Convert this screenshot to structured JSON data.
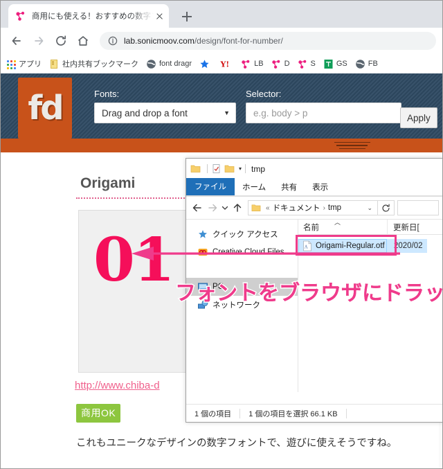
{
  "browser": {
    "tab": {
      "title": "商用にも使える！おすすめの数字フォ",
      "favicon": "fontdragr-icon",
      "close": "close-icon"
    },
    "new_tab_label": "+",
    "nav": {
      "back": "back-arrow-icon",
      "forward": "forward-arrow-icon",
      "reload": "reload-icon",
      "home": "home-icon"
    },
    "omnibox": {
      "info_icon": "info-circle-icon",
      "url_domain": "lab.sonicmoov.com",
      "url_path": "/design/font-for-number/"
    },
    "bookmarks": [
      {
        "label": "アプリ",
        "icon": "apps-grid-icon"
      },
      {
        "label": "社内共有ブックマーク",
        "icon": "document-icon"
      },
      {
        "label": "font dragr",
        "icon": "globe-icon"
      },
      {
        "label": "",
        "icon": "star-icon"
      },
      {
        "label": "",
        "icon": "yahoo-icon"
      },
      {
        "label": "LB",
        "icon": "fontdragr-icon"
      },
      {
        "label": "D",
        "icon": "fontdragr-icon"
      },
      {
        "label": "S",
        "icon": "fontdragr-icon"
      },
      {
        "label": "GS",
        "icon": "sheets-icon"
      },
      {
        "label": "FB",
        "icon": "globe-icon"
      }
    ]
  },
  "fontdragr": {
    "logo_text": "fd",
    "fonts_label": "Fonts:",
    "fonts_selected": "Drag and drop a font",
    "selector_label": "Selector:",
    "selector_placeholder": "e.g. body > p",
    "apply_label": "Apply",
    "colors": {
      "bar": "#2f4a63",
      "accent": "#c8521a"
    }
  },
  "page": {
    "heading": "Origami",
    "sample_number": "01",
    "link_text": "http://www.chiba-d",
    "badge": "商用OK",
    "paragraph": "これもユニークなデザインの数字フォントで、遊びに使えそうですね。",
    "colors": {
      "sample": "#f50f5a",
      "link": "#f0608c",
      "badge_bg": "#8dc63f"
    }
  },
  "annotation": {
    "caption": "フォントをブラウザにドラッグ",
    "arrow": "left-arrow-annotation",
    "color": "#ef3b8b"
  },
  "explorer": {
    "title": "tmp",
    "quick_access_icons": [
      "folder-icon",
      "properties-icon",
      "new-folder-icon",
      "customize-caret-icon"
    ],
    "ribbon_tabs": [
      "ファイル",
      "ホーム",
      "共有",
      "表示"
    ],
    "address": {
      "back": "back-arrow-icon",
      "forward": "forward-arrow-icon",
      "recent": "chevron-down-icon",
      "up": "up-arrow-icon",
      "crumb_icon": "folder-icon",
      "crumb_prefix": "«",
      "crumb_1": "ドキュメント",
      "crumb_sep": "›",
      "crumb_2": "tmp",
      "dropdown": "chevron-down-icon",
      "refresh": "refresh-icon"
    },
    "nav_items": [
      {
        "label": "クイック アクセス",
        "icon": "star-pin-icon",
        "selected": false
      },
      {
        "label": "Creative Cloud Files",
        "icon": "creative-cloud-icon",
        "selected": false
      },
      {
        "label": "PC",
        "icon": "this-pc-icon",
        "selected": true
      },
      {
        "label": "ネットワーク",
        "icon": "network-icon",
        "selected": false
      }
    ],
    "columns": [
      "名前",
      "更新日[",
      "sort-ascending-caret"
    ],
    "rows": [
      {
        "name": "Origami-Regular.otf",
        "icon": "font-file-icon",
        "date": "2020/02",
        "selected": true
      }
    ],
    "status": [
      "1 個の項目",
      "1 個の項目を選択  66.1 KB"
    ]
  }
}
